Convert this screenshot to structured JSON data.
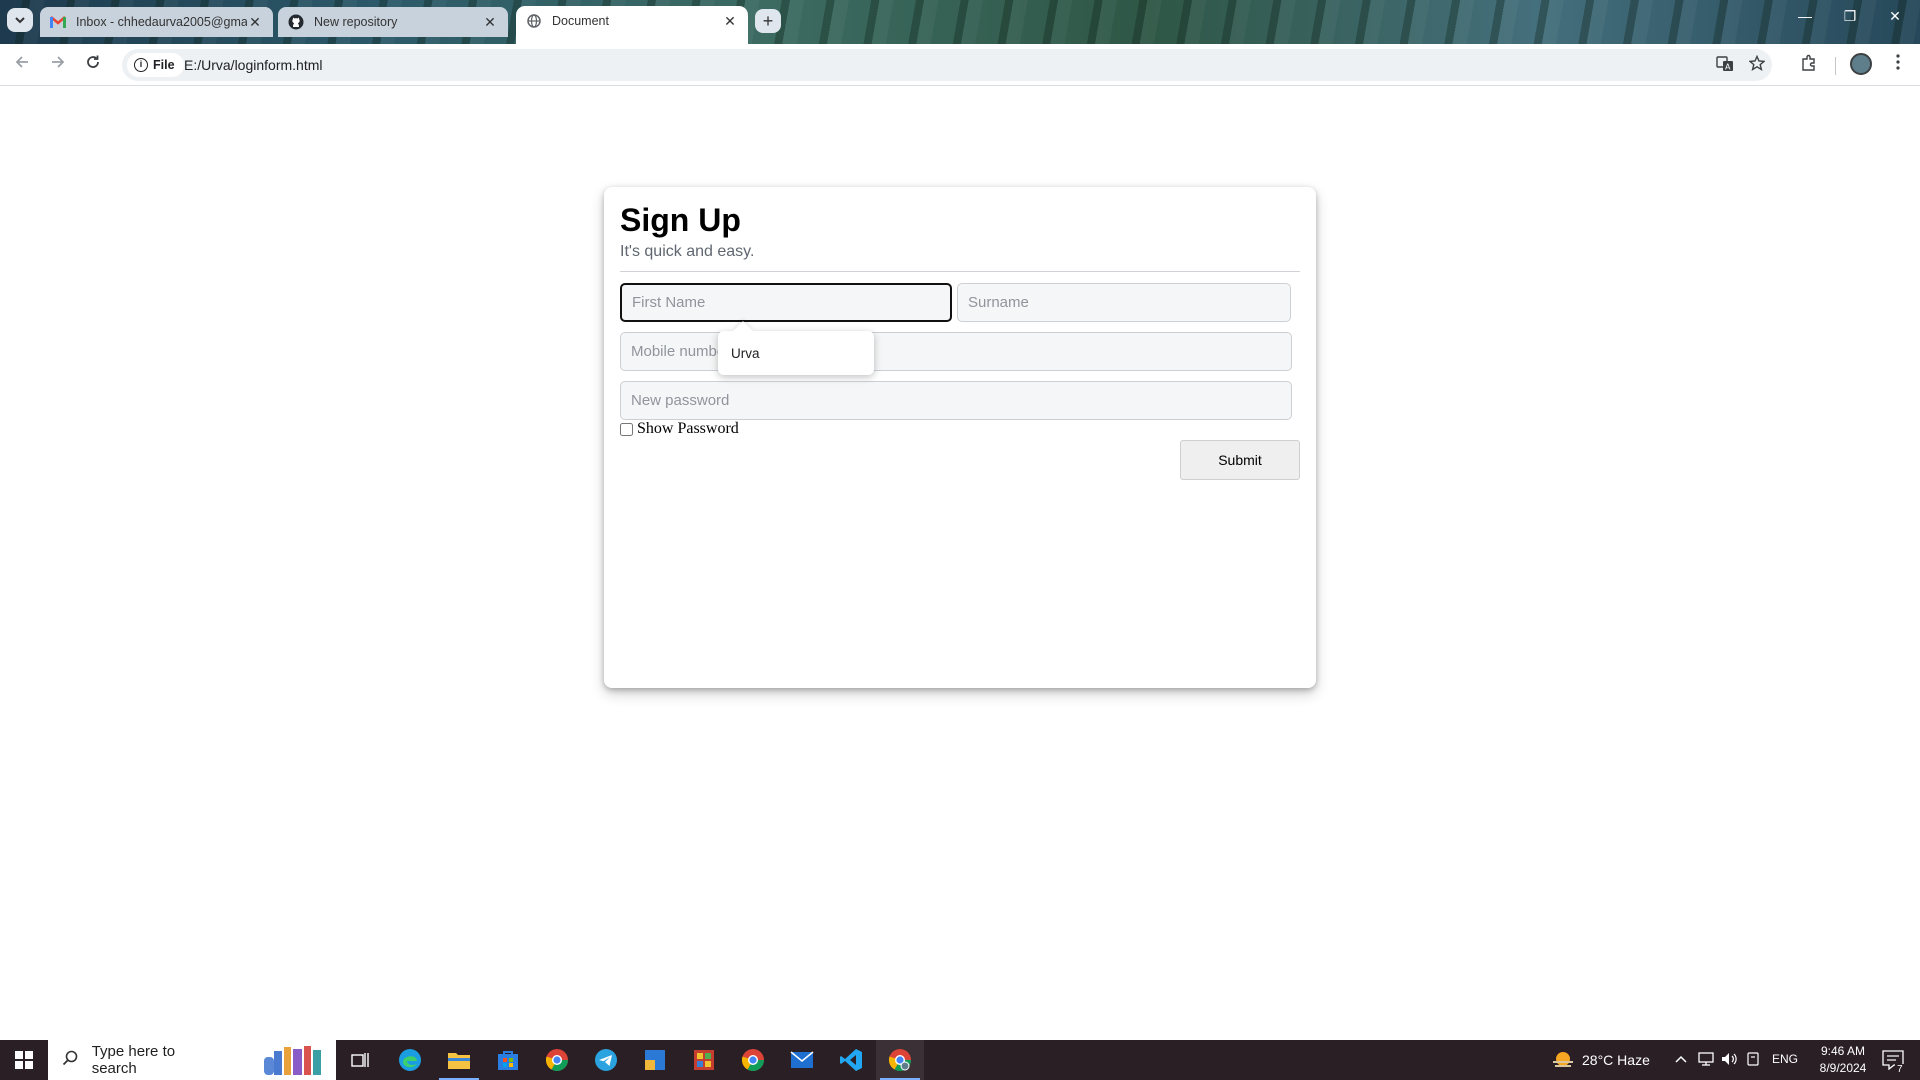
{
  "browser": {
    "tabs": [
      {
        "title": "Inbox - chhedaurva2005@gma",
        "favicon": "gmail-icon",
        "close": "✕"
      },
      {
        "title": "New repository",
        "favicon": "github-icon",
        "close": "✕"
      },
      {
        "title": "Document",
        "favicon": "globe-icon",
        "close": "✕"
      }
    ],
    "new_tab": "+",
    "window_controls": {
      "minimize": "—",
      "restore": "❐",
      "close": "✕"
    },
    "site_chip": "File",
    "url": "E:/Urva/loginform.html"
  },
  "form": {
    "title": "Sign Up",
    "subtitle": "It's quick and easy.",
    "first_name_placeholder": "First Name",
    "surname_placeholder": "Surname",
    "mobile_placeholder": "Mobile number",
    "password_placeholder": "New password",
    "show_password_label": "Show Password",
    "submit_label": "Submit",
    "autofill_suggestion": "Urva"
  },
  "taskbar": {
    "search_placeholder": "Type here to search",
    "weather": "28°C  Haze",
    "language": "ENG",
    "time": "9:46 AM",
    "date": "8/9/2024",
    "notification_count": "7"
  },
  "colors": {
    "taskbar": "#2a1f24",
    "accent": "#7ab0ff"
  }
}
